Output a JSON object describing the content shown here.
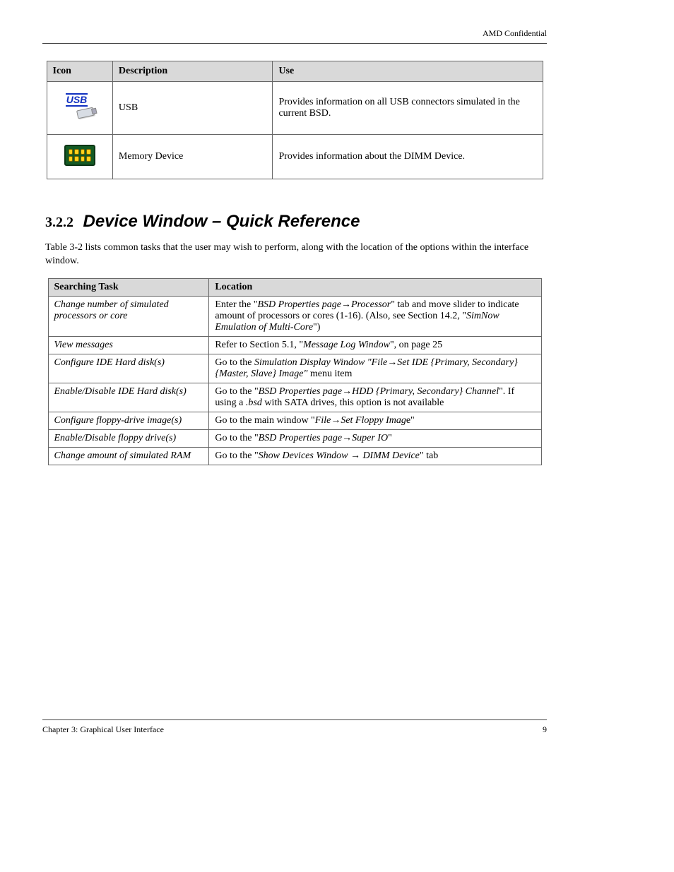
{
  "page_header": "AMD Confidential",
  "icon_table": {
    "headers": [
      "Icon",
      "Description",
      "Use"
    ],
    "rows": [
      {
        "img": "usb",
        "desc": "USB",
        "use": "Provides information on all USB connectors simulated in the current BSD."
      },
      {
        "img": "chip",
        "desc": "Memory Device",
        "use": "Provides information about the DIMM Device."
      }
    ]
  },
  "section": {
    "number": "3.2.2",
    "title": "Device Window – Quick Reference"
  },
  "intro_paragraph": "Table 3-2 lists common tasks that the user may wish to perform, along with the location of the options within the interface window.",
  "common_table": {
    "headers": [
      "Searching Task",
      "Location"
    ],
    "rows": [
      {
        "search": "Change number of simulated processors or core",
        "loc_parts": [
          {
            "t": "Enter the \"",
            "i": false
          },
          {
            "t": "BSD P",
            "i": true
          },
          {
            "t": "roperties page→Processor",
            "i": true
          },
          {
            "t": "\" tab and move slider to indicate amount of processors or cores (1-16). (Also, see Section ",
            "i": false
          },
          {
            "t": "14.2",
            "i": false
          },
          {
            "t": ", \"",
            "i": false
          },
          {
            "t": "SimNow Emulation of Multi-Core",
            "i": true
          },
          {
            "t": "\")",
            "i": false
          }
        ]
      },
      {
        "search": "View messages",
        "loc_parts": [
          {
            "t": "Refer to Section ",
            "i": false
          },
          {
            "t": "5.1",
            "i": false
          },
          {
            "t": ", \"",
            "i": false
          },
          {
            "t": "Message Log Window",
            "i": true
          },
          {
            "t": "\", on page ",
            "i": false
          },
          {
            "t": "25",
            "i": false
          }
        ]
      },
      {
        "search": "Configure IDE Hard disk(s)",
        "loc_parts": [
          {
            "t": "Go to the ",
            "i": false
          },
          {
            "t": "Simulation Display Window \"File→Set IDE {Primary, Secondary} {Master, Slave} Image\"",
            "i": true
          },
          {
            "t": " menu item",
            "i": false
          }
        ]
      },
      {
        "search": "Enable/Disable IDE Hard disk(s)",
        "loc_parts": [
          {
            "t": "Go to the \"",
            "i": false
          },
          {
            "t": "BSD P",
            "i": true
          },
          {
            "t": "roperties page→HDD {Primary, Secondary} Channel",
            "i": true
          },
          {
            "t": "\". If using a ",
            "i": false
          },
          {
            "t": ".bsd",
            "i": true
          },
          {
            "t": " with SATA drives, this option is not available",
            "i": false
          }
        ]
      },
      {
        "search": "Configure floppy-drive image(s)",
        "loc_parts": [
          {
            "t": "Go to the main window \"",
            "i": false
          },
          {
            "t": "File",
            "i": true
          },
          {
            "t": "→Set Floppy Imag",
            "i": true
          },
          {
            "t": "e\"",
            "i": false
          }
        ]
      },
      {
        "search": "Enable/Disable floppy drive(s)",
        "loc_parts": [
          {
            "t": "Go to the \"",
            "i": false
          },
          {
            "t": "BSD P",
            "i": true
          },
          {
            "t": "roperties page→Super IO",
            "i": true
          },
          {
            "t": "\"",
            "i": false
          }
        ]
      },
      {
        "search": "Change amount of simulated RAM",
        "loc_parts": [
          {
            "t": "Go to the \"",
            "i": false
          },
          {
            "t": "Show Devices Window",
            "i": true
          },
          {
            "t": " → ",
            "i": false
          },
          {
            "t": "DIMM Device",
            "i": true
          },
          {
            "t": "\" tab",
            "i": false
          }
        ]
      }
    ]
  },
  "footer": {
    "left": "Chapter 3: Graphical User Interface",
    "right": "9"
  }
}
